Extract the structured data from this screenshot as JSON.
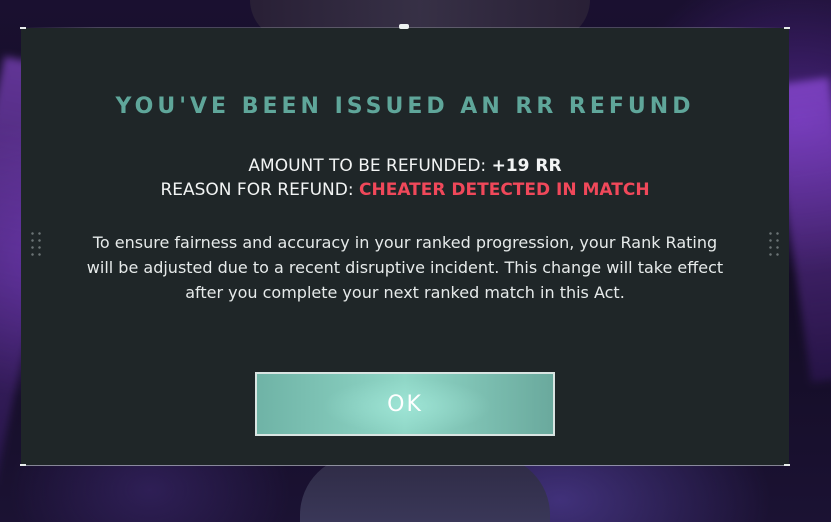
{
  "dialog": {
    "title": "YOU'VE BEEN ISSUED AN RR REFUND",
    "amount_label": "AMOUNT TO BE REFUNDED: ",
    "amount_value": "+19 RR",
    "reason_label": "REASON FOR REFUND: ",
    "reason_value": "CHEATER DETECTED IN MATCH",
    "body": "To ensure fairness and accuracy in your ranked progression, your Rank Rating will be adjusted due to a recent disruptive incident. This change will take effect after you complete your next ranked match in this Act.",
    "ok_label": "OK"
  },
  "colors": {
    "title": "#5fa69a",
    "reason": "#f0485a",
    "panel": "#1f2628",
    "button": "#8fd6c6"
  }
}
